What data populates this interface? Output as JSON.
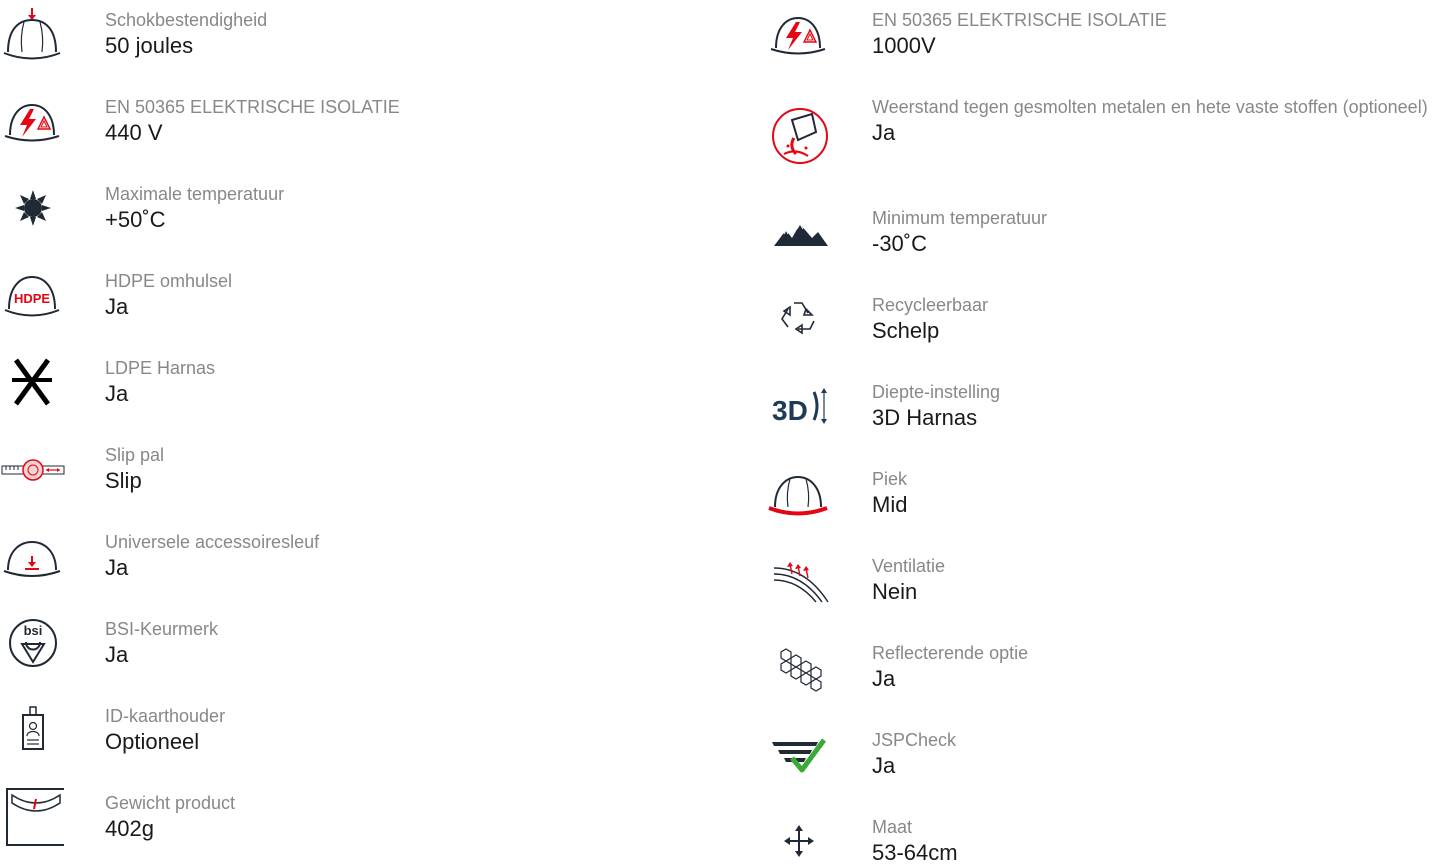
{
  "colors": {
    "accent": "#e30613",
    "icon": "#1f2a36",
    "label": "#888888",
    "value": "#1a1a1a",
    "check": "#3aaa35"
  },
  "left": [
    {
      "icon": "helmet-impact-icon",
      "label": "Schokbestendigheid",
      "value": "50 joules"
    },
    {
      "icon": "helmet-electrical-icon",
      "label": "EN 50365 ELEKTRISCHE ISOLATIE",
      "value": "440 V"
    },
    {
      "icon": "sun-icon",
      "label": "Maximale temperatuur",
      "value": "+50˚C"
    },
    {
      "icon": "helmet-hdpe-icon",
      "label": "HDPE omhulsel",
      "value": "Ja",
      "icon_text": "HDPE"
    },
    {
      "icon": "harness-icon",
      "label": "LDPE Harnas",
      "value": "Ja"
    },
    {
      "icon": "slip-ratchet-icon",
      "label": "Slip pal",
      "value": "Slip"
    },
    {
      "icon": "helmet-accessory-slot-icon",
      "label": "Universele accessoiresleuf",
      "value": "Ja"
    },
    {
      "icon": "bsi-kitemark-icon",
      "label": "BSI-Keurmerk",
      "value": "Ja",
      "icon_text": "bsi"
    },
    {
      "icon": "id-card-holder-icon",
      "label": "ID-kaarthouder",
      "value": "Optioneel"
    },
    {
      "icon": "weight-scale-icon",
      "label": "Gewicht product",
      "value": "402g"
    }
  ],
  "right": [
    {
      "icon": "helmet-electrical-icon",
      "label": "EN 50365 ELEKTRISCHE ISOLATIE",
      "value": "1000V"
    },
    {
      "icon": "molten-metal-icon",
      "label": "Weerstand tegen gesmolten metalen en hete vaste stoffen (optioneel)",
      "value": "Ja"
    },
    {
      "icon": "mountains-icon",
      "label": "Minimum temperatuur",
      "value": "-30˚C"
    },
    {
      "icon": "recycle-icon",
      "label": "Recycleerbaar",
      "value": "Schelp"
    },
    {
      "icon": "3d-depth-icon",
      "label": "Diepte-instelling",
      "value": "3D Harnas",
      "icon_text": "3D"
    },
    {
      "icon": "helmet-peak-icon",
      "label": "Piek",
      "value": "Mid"
    },
    {
      "icon": "ventilation-icon",
      "label": "Ventilatie",
      "value": "Nein"
    },
    {
      "icon": "reflective-hexagon-icon",
      "label": "Reflecterende optie",
      "value": "Ja"
    },
    {
      "icon": "jspcheck-icon",
      "label": "JSPCheck",
      "value": "Ja"
    },
    {
      "icon": "move-arrows-icon",
      "label": "Maat",
      "value": "53-64cm"
    }
  ]
}
